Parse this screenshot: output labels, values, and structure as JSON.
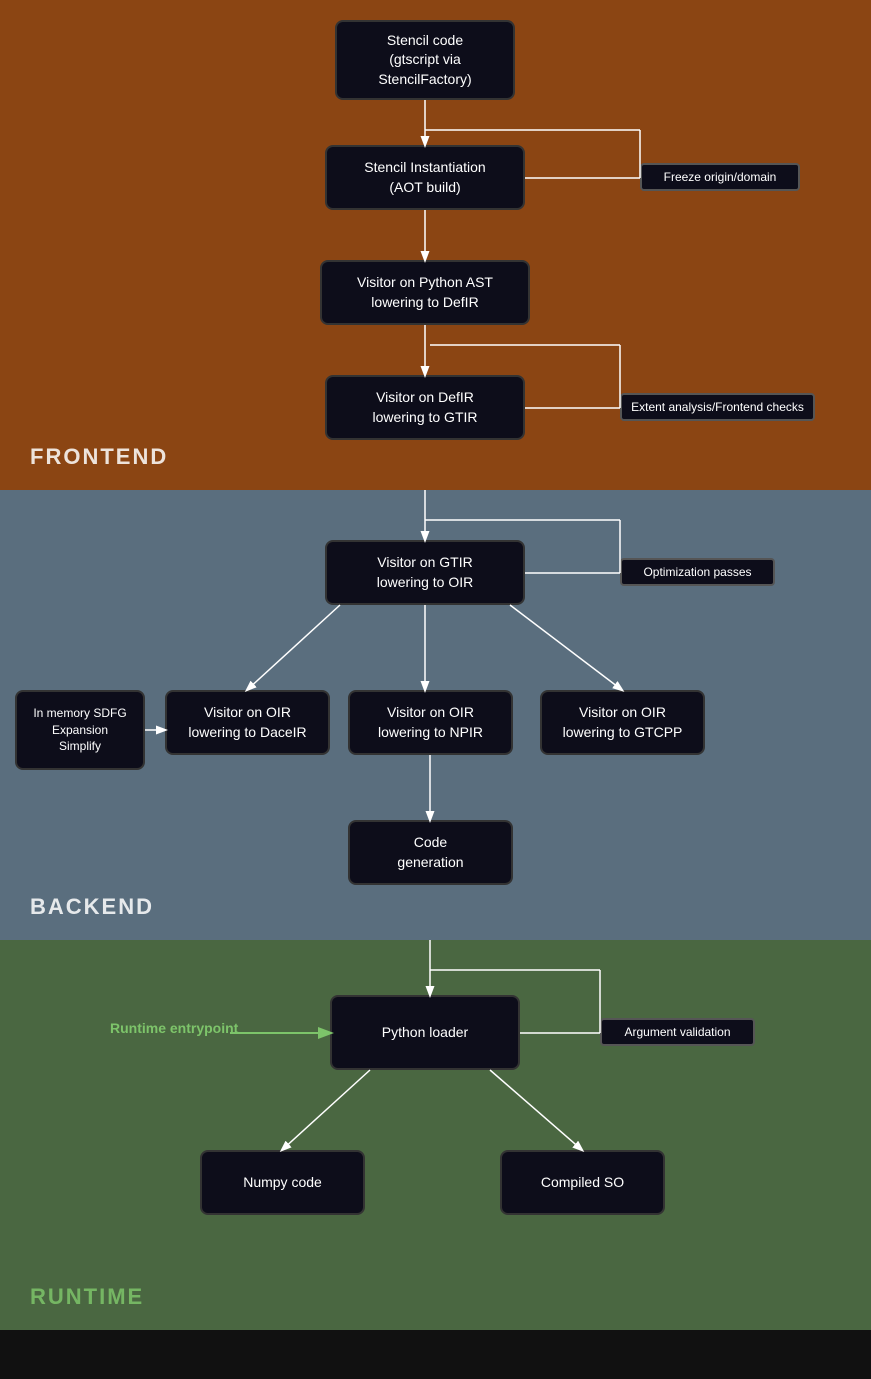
{
  "sections": {
    "frontend": {
      "label": "FRONTEND",
      "color": "#8B4513"
    },
    "backend": {
      "label": "BACKEND",
      "color": "#5A6E7E"
    },
    "runtime": {
      "label": "RUNTIME",
      "color": "#4A6741"
    }
  },
  "boxes": {
    "stencil_code": "Stencil code\n(gtscript via\nStencilFactory)",
    "stencil_instantiation": "Stencil Instantiation\n(AOT build)",
    "freeze_origin": "Freeze origin/domain",
    "visitor_python_ast": "Visitor on Python AST\nlowering to DefIR",
    "visitor_defir": "Visitor on DefIR\nlowering to GTIR",
    "extent_analysis": "Extent analysis/Frontend checks",
    "visitor_gtir": "Visitor on GTIR\nlowering to OIR",
    "optimization_passes": "Optimization passes",
    "visitor_oir_dacelr": "Visitor on OIR\nlowering to DaceIR",
    "visitor_oir_npir": "Visitor on OIR\nlowering to NPIR",
    "visitor_oir_gtcpp": "Visitor on OIR\nlowering to GTCPP",
    "in_memory_sdfg": "In memory SDFG\nExpansion\nSimplify",
    "code_generation": "Code\ngeneration",
    "python_loader": "Python loader",
    "runtime_entrypoint": "Runtime entrypoint",
    "argument_validation": "Argument validation",
    "numpy_code": "Numpy code",
    "compiled_so": "Compiled SO"
  }
}
